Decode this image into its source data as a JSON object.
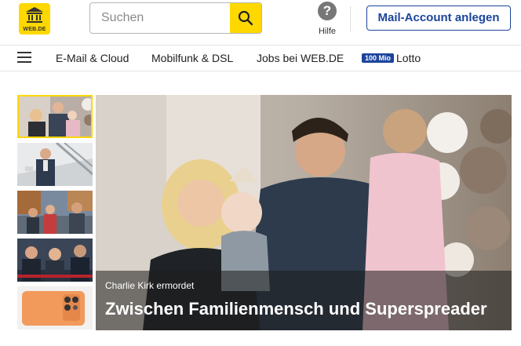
{
  "brand": {
    "logo_text": "WEB.DE",
    "accent": "#ffd800",
    "primary": "#1c449b"
  },
  "search": {
    "placeholder": "Suchen",
    "icon": "search-icon"
  },
  "help": {
    "label": "Hilfe",
    "glyph": "?"
  },
  "cta": {
    "label": "Mail-Account anlegen"
  },
  "nav": {
    "menu_icon": "hamburger-icon",
    "items": [
      {
        "label": "E-Mail & Cloud"
      },
      {
        "label": "Mobilfunk & DSL"
      },
      {
        "label": "Jobs bei WEB.DE"
      },
      {
        "label": "Lotto",
        "badge": "100 Mio"
      }
    ]
  },
  "hero": {
    "kicker": "Charlie Kirk ermordet",
    "title": "Zwischen Familienmensch und Superspreader"
  },
  "thumbnails": [
    {
      "name": "thumb-family",
      "active": true
    },
    {
      "name": "thumb-man-in-hall"
    },
    {
      "name": "thumb-street-people"
    },
    {
      "name": "thumb-politicians"
    },
    {
      "name": "thumb-orange-phone"
    }
  ]
}
